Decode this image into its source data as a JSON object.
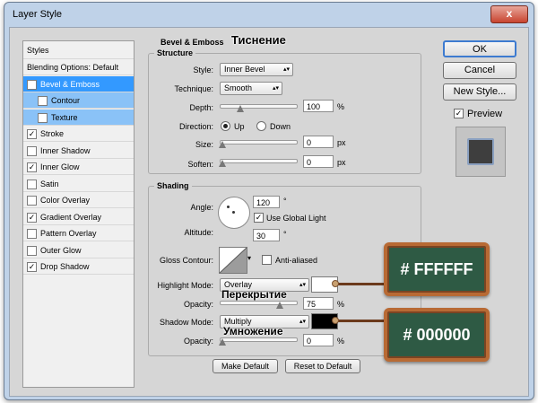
{
  "window": {
    "title": "Layer Style",
    "close_glyph": "x"
  },
  "styles_panel": {
    "header": "Styles",
    "items": [
      {
        "label": "Blending Options: Default",
        "checkbox": false,
        "checked": false,
        "state": "normal",
        "indent": false
      },
      {
        "label": "Bevel & Emboss",
        "checkbox": true,
        "checked": true,
        "state": "selected",
        "indent": false
      },
      {
        "label": "Contour",
        "checkbox": true,
        "checked": false,
        "state": "sub",
        "indent": true
      },
      {
        "label": "Texture",
        "checkbox": true,
        "checked": false,
        "state": "sub",
        "indent": true
      },
      {
        "label": "Stroke",
        "checkbox": true,
        "checked": true,
        "state": "normal",
        "indent": false
      },
      {
        "label": "Inner Shadow",
        "checkbox": true,
        "checked": false,
        "state": "normal",
        "indent": false
      },
      {
        "label": "Inner Glow",
        "checkbox": true,
        "checked": true,
        "state": "normal",
        "indent": false
      },
      {
        "label": "Satin",
        "checkbox": true,
        "checked": false,
        "state": "normal",
        "indent": false
      },
      {
        "label": "Color Overlay",
        "checkbox": true,
        "checked": false,
        "state": "normal",
        "indent": false
      },
      {
        "label": "Gradient Overlay",
        "checkbox": true,
        "checked": true,
        "state": "normal",
        "indent": false
      },
      {
        "label": "Pattern Overlay",
        "checkbox": true,
        "checked": false,
        "state": "normal",
        "indent": false
      },
      {
        "label": "Outer Glow",
        "checkbox": true,
        "checked": false,
        "state": "normal",
        "indent": false
      },
      {
        "label": "Drop Shadow",
        "checkbox": true,
        "checked": true,
        "state": "normal",
        "indent": false
      }
    ]
  },
  "bevel": {
    "title": "Bevel & Emboss",
    "annotation": "Тиснение",
    "structure": {
      "legend": "Structure",
      "style_label": "Style:",
      "style_value": "Inner Bevel",
      "technique_label": "Technique:",
      "technique_value": "Smooth",
      "depth_label": "Depth:",
      "depth_value": "100",
      "depth_unit": "%",
      "direction_label": "Direction:",
      "direction_up": "Up",
      "direction_down": "Down",
      "size_label": "Size:",
      "size_value": "0",
      "size_unit": "px",
      "soften_label": "Soften:",
      "soften_value": "0",
      "soften_unit": "px"
    },
    "shading": {
      "legend": "Shading",
      "angle_label": "Angle:",
      "angle_value": "120",
      "angle_unit": "°",
      "global_light_label": "Use Global Light",
      "altitude_label": "Altitude:",
      "altitude_value": "30",
      "altitude_unit": "°",
      "gloss_label": "Gloss Contour:",
      "anti_aliased_label": "Anti-aliased",
      "highlight_mode_label": "Highlight Mode:",
      "highlight_mode_value": "Overlay",
      "highlight_color": "#ffffff",
      "highlight_annotation": "Перекрытие",
      "h_opacity_label": "Opacity:",
      "h_opacity_value": "75",
      "h_opacity_unit": "%",
      "shadow_mode_label": "Shadow Mode:",
      "shadow_mode_value": "Multiply",
      "shadow_color": "#000000",
      "shadow_annotation": "Умножение",
      "s_opacity_label": "Opacity:",
      "s_opacity_value": "0",
      "s_opacity_unit": "%"
    },
    "make_default": "Make Default",
    "reset_default": "Reset to Default"
  },
  "side_buttons": {
    "ok": "OK",
    "cancel": "Cancel",
    "new_style": "New Style...",
    "preview": "Preview"
  },
  "callouts": {
    "highlight_hex": "# FFFFFF",
    "shadow_hex": "# 000000"
  },
  "colors": {
    "selected": "#3399ff",
    "sub_selected": "#8ac2f7",
    "board": "#2e5a44",
    "board_frame": "#b86a34"
  }
}
